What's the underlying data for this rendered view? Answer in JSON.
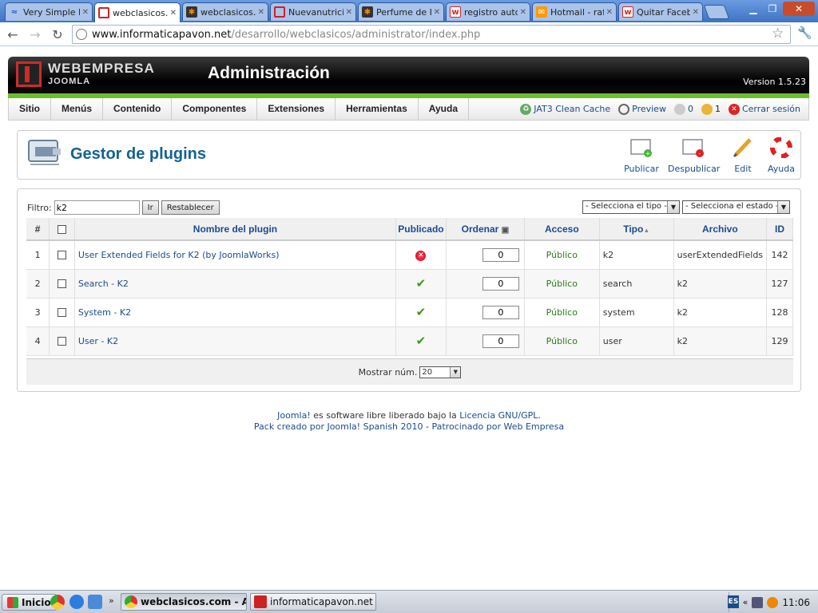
{
  "browser": {
    "tabs": [
      {
        "title": "Very Simple I",
        "active": false
      },
      {
        "title": "webclasicos.",
        "active": true
      },
      {
        "title": "webclasicos.",
        "active": false
      },
      {
        "title": "Nuevanutrici",
        "active": false
      },
      {
        "title": "Perfume de I",
        "active": false
      },
      {
        "title": "registro autc",
        "active": false
      },
      {
        "title": "Hotmail - raf",
        "active": false
      },
      {
        "title": "Quitar Faceb",
        "active": false
      }
    ],
    "url_host": "www.informaticapavon.net",
    "url_path": "/desarrollo/webclasicos/administrator/index.php"
  },
  "header": {
    "brand": "WEBEMPRESA",
    "brand_sub": "JOOMLA",
    "title": "Administración",
    "version": "Version 1.5.23"
  },
  "menu": {
    "items": [
      "Sitio",
      "Menús",
      "Contenido",
      "Componentes",
      "Extensiones",
      "Herramientas",
      "Ayuda"
    ],
    "status": {
      "cache": "JAT3 Clean Cache",
      "preview": "Preview",
      "messages": "0",
      "users": "1",
      "logout": "Cerrar sesión"
    }
  },
  "toolbar": {
    "title": "Gestor de plugins",
    "buttons": [
      "Publicar",
      "Despublicar",
      "Edit",
      "Ayuda"
    ]
  },
  "filter": {
    "label": "Filtro:",
    "value": "k2",
    "go": "Ir",
    "reset": "Restablecer",
    "type_select": "- Selecciona el tipo -",
    "state_select": "- Selecciona el estado -"
  },
  "table": {
    "headers": {
      "num": "#",
      "name": "Nombre del plugin",
      "published": "Publicado",
      "order": "Ordenar",
      "access": "Acceso",
      "type": "Tipo",
      "file": "Archivo",
      "id": "ID"
    },
    "rows": [
      {
        "num": "1",
        "name": "User Extended Fields for K2 (by JoomlaWorks)",
        "published": false,
        "order": "0",
        "access": "Público",
        "type": "k2",
        "file": "userExtendedFields",
        "id": "142"
      },
      {
        "num": "2",
        "name": "Search - K2",
        "published": true,
        "order": "0",
        "access": "Público",
        "type": "search",
        "file": "k2",
        "id": "127"
      },
      {
        "num": "3",
        "name": "System - K2",
        "published": true,
        "order": "0",
        "access": "Público",
        "type": "system",
        "file": "k2",
        "id": "128"
      },
      {
        "num": "4",
        "name": "User - K2",
        "published": true,
        "order": "0",
        "access": "Público",
        "type": "user",
        "file": "k2",
        "id": "129"
      }
    ]
  },
  "pager": {
    "label": "Mostrar núm.",
    "value": "20"
  },
  "footer": {
    "joomla": "Joomla!",
    "text1": "es software libre liberado bajo la",
    "license": "Licencia GNU/GPL",
    "dot": ".",
    "pack": "Pack creado por Joomla! Spanish 2010",
    "dash": "-",
    "sponsor": "Patrocinado por Web Empresa"
  },
  "taskbar": {
    "start": "Inicio",
    "tasks": [
      "webclasicos.com - Ad...",
      "informaticapavon.net - i..."
    ],
    "lang": "ES",
    "time": "11:06"
  },
  "colors": {
    "link": "#1c4b8c",
    "title_blue": "#146295",
    "header_green": "#6cbf2c",
    "public_green": "#2a7a17"
  }
}
